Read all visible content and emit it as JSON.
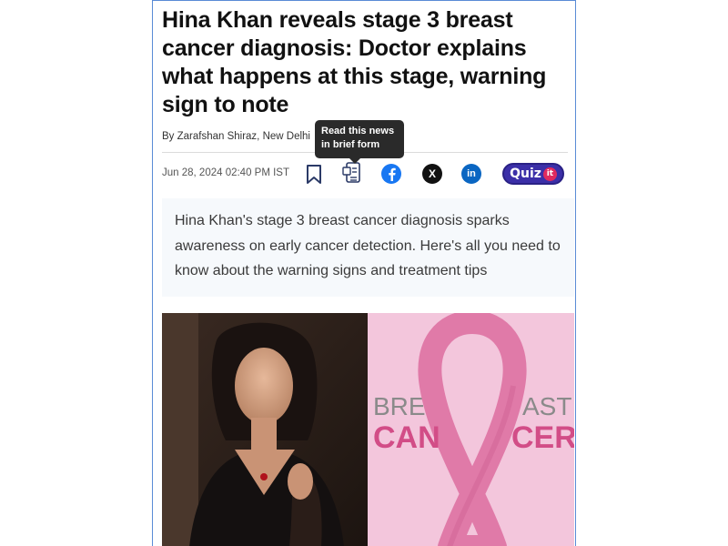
{
  "article": {
    "headline": "Hina Khan reveals stage 3 breast cancer diagnosis: Doctor explains what happens at this stage, warning sign to note",
    "byline": "By Zarafshan Shiraz, New Delhi",
    "date": "Jun 28, 2024 02:40 PM IST",
    "summary": "Hina Khan's stage 3 breast cancer diagnosis sparks awareness on early cancer detection. Here's all you need to know about the warning signs and treatment tips"
  },
  "toolbar": {
    "tooltip": "Read this news in brief form",
    "quiz_label": "Quiz",
    "quiz_badge": "it",
    "x_label": "X",
    "linkedin_label": "in"
  },
  "hero": {
    "ribbon_text_top_left": "BRE",
    "ribbon_text_top_right": "AST",
    "ribbon_text_bottom_left": "CAN",
    "ribbon_text_bottom_right": "CER"
  },
  "colors": {
    "facebook": "#1877f2",
    "linkedin": "#0a66c2",
    "quiz": "#3b2fa8",
    "ribbon_bg": "#f3c6dc",
    "ribbon": "#e07aa8"
  }
}
